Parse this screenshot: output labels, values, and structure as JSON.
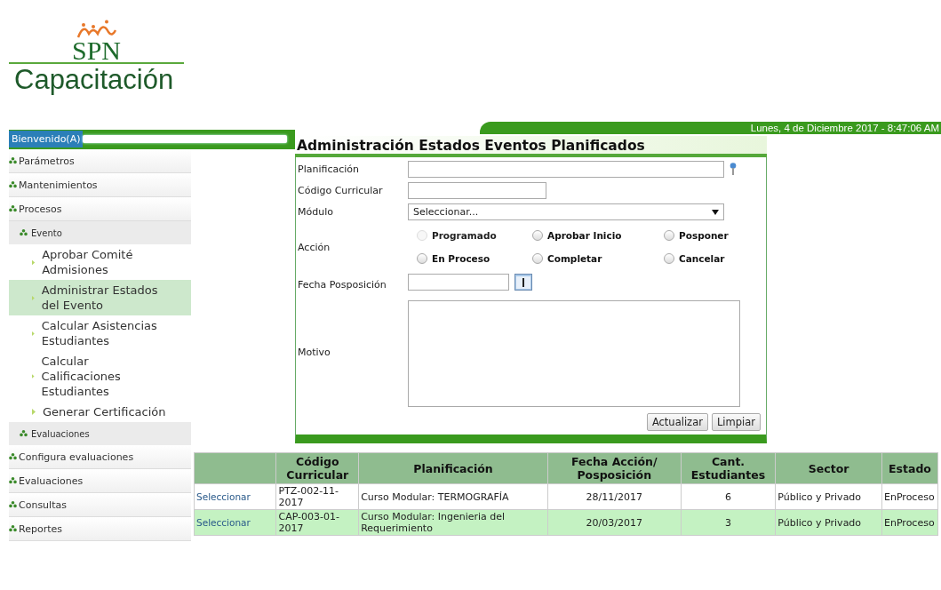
{
  "logo": {
    "mark": "SPN",
    "name": "Capacitación"
  },
  "header": {
    "welcome": "Bienvenido(A)",
    "date": "Lunes, 4 de Diciembre 2017 - 8:47:06 AM"
  },
  "sidebar": {
    "items": [
      {
        "label": "Parámetros"
      },
      {
        "label": "Mantenimientos"
      },
      {
        "label": "Procesos",
        "children": [
          {
            "label": "Evento",
            "children": [
              {
                "label": "Aprobar Comité Admisiones",
                "selected": false
              },
              {
                "label": "Administrar Estados del Evento",
                "selected": true
              },
              {
                "label": "Calcular Asistencias Estudiantes",
                "selected": false
              },
              {
                "label": "Calcular Calificaciones Estudiantes",
                "selected": false
              },
              {
                "label": "Generar Certificación",
                "selected": false
              }
            ]
          },
          {
            "label": "Evaluaciones"
          }
        ]
      },
      {
        "label": "Configura evaluaciones"
      },
      {
        "label": "Evaluaciones"
      },
      {
        "label": "Consultas"
      },
      {
        "label": "Reportes"
      }
    ]
  },
  "form": {
    "title": "Administración Estados Eventos Planificados",
    "planificacion": {
      "label": "Planificación"
    },
    "codigo": {
      "label": "Código Curricular"
    },
    "modulo": {
      "label": "Módulo",
      "value": "Seleccionar..."
    },
    "accion": {
      "label": "Acción",
      "options": [
        {
          "label": "Programado",
          "checked": false,
          "disabled": true
        },
        {
          "label": "Aprobar Inicio",
          "checked": false,
          "disabled": false
        },
        {
          "label": "Posponer",
          "checked": false,
          "disabled": false
        },
        {
          "label": "En Proceso",
          "checked": false,
          "disabled": false
        },
        {
          "label": "Completar",
          "checked": false,
          "disabled": false
        },
        {
          "label": "Cancelar",
          "checked": false,
          "disabled": false
        }
      ]
    },
    "fecha": {
      "label": "Fecha Posposición"
    },
    "motivo": {
      "label": "Motivo"
    },
    "buttons": [
      "Actualizar",
      "Limpiar"
    ]
  },
  "table": {
    "columns": [
      "Código Curricular",
      "Planificación",
      "Fecha Acción/ Posposición",
      "Cant. Estudiantes",
      "Sector",
      "Estado"
    ],
    "rows": [
      {
        "action": "Seleccionar",
        "cells": [
          "PTZ-002-11-2017",
          "Curso Modular: TERMOGRAFÍA",
          "28/11/2017",
          "6",
          "Público y Privado",
          "EnProceso"
        ]
      },
      {
        "action": "Seleccionar",
        "cells": [
          "CAP-003-01-2017",
          "Curso Modular: Ingenieria del Requerimiento",
          "20/03/2017",
          "3",
          "Público y Privado",
          "EnProceso"
        ]
      }
    ]
  }
}
